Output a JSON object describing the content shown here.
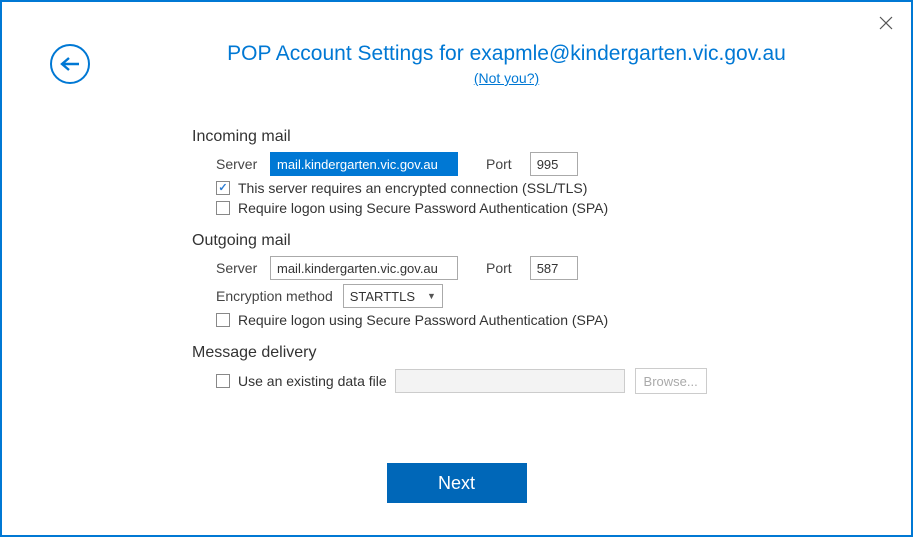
{
  "title_prefix": "POP Account Settings for ",
  "email": "exapmle@kindergarten.vic.gov.au",
  "not_you": "(Not you?)",
  "incoming": {
    "heading": "Incoming mail",
    "server_label": "Server",
    "server_value": "mail.kindergarten.vic.gov.au",
    "port_label": "Port",
    "port_value": "995",
    "ssl_label": "This server requires an encrypted connection (SSL/TLS)",
    "ssl_checked": true,
    "spa_label": "Require logon using Secure Password Authentication (SPA)",
    "spa_checked": false
  },
  "outgoing": {
    "heading": "Outgoing mail",
    "server_label": "Server",
    "server_value": "mail.kindergarten.vic.gov.au",
    "port_label": "Port",
    "port_value": "587",
    "encryption_label": "Encryption method",
    "encryption_value": "STARTTLS",
    "spa_label": "Require logon using Secure Password Authentication (SPA)",
    "spa_checked": false
  },
  "delivery": {
    "heading": "Message delivery",
    "use_existing_label": "Use an existing data file",
    "use_existing_checked": false,
    "browse_label": "Browse..."
  },
  "next_label": "Next"
}
